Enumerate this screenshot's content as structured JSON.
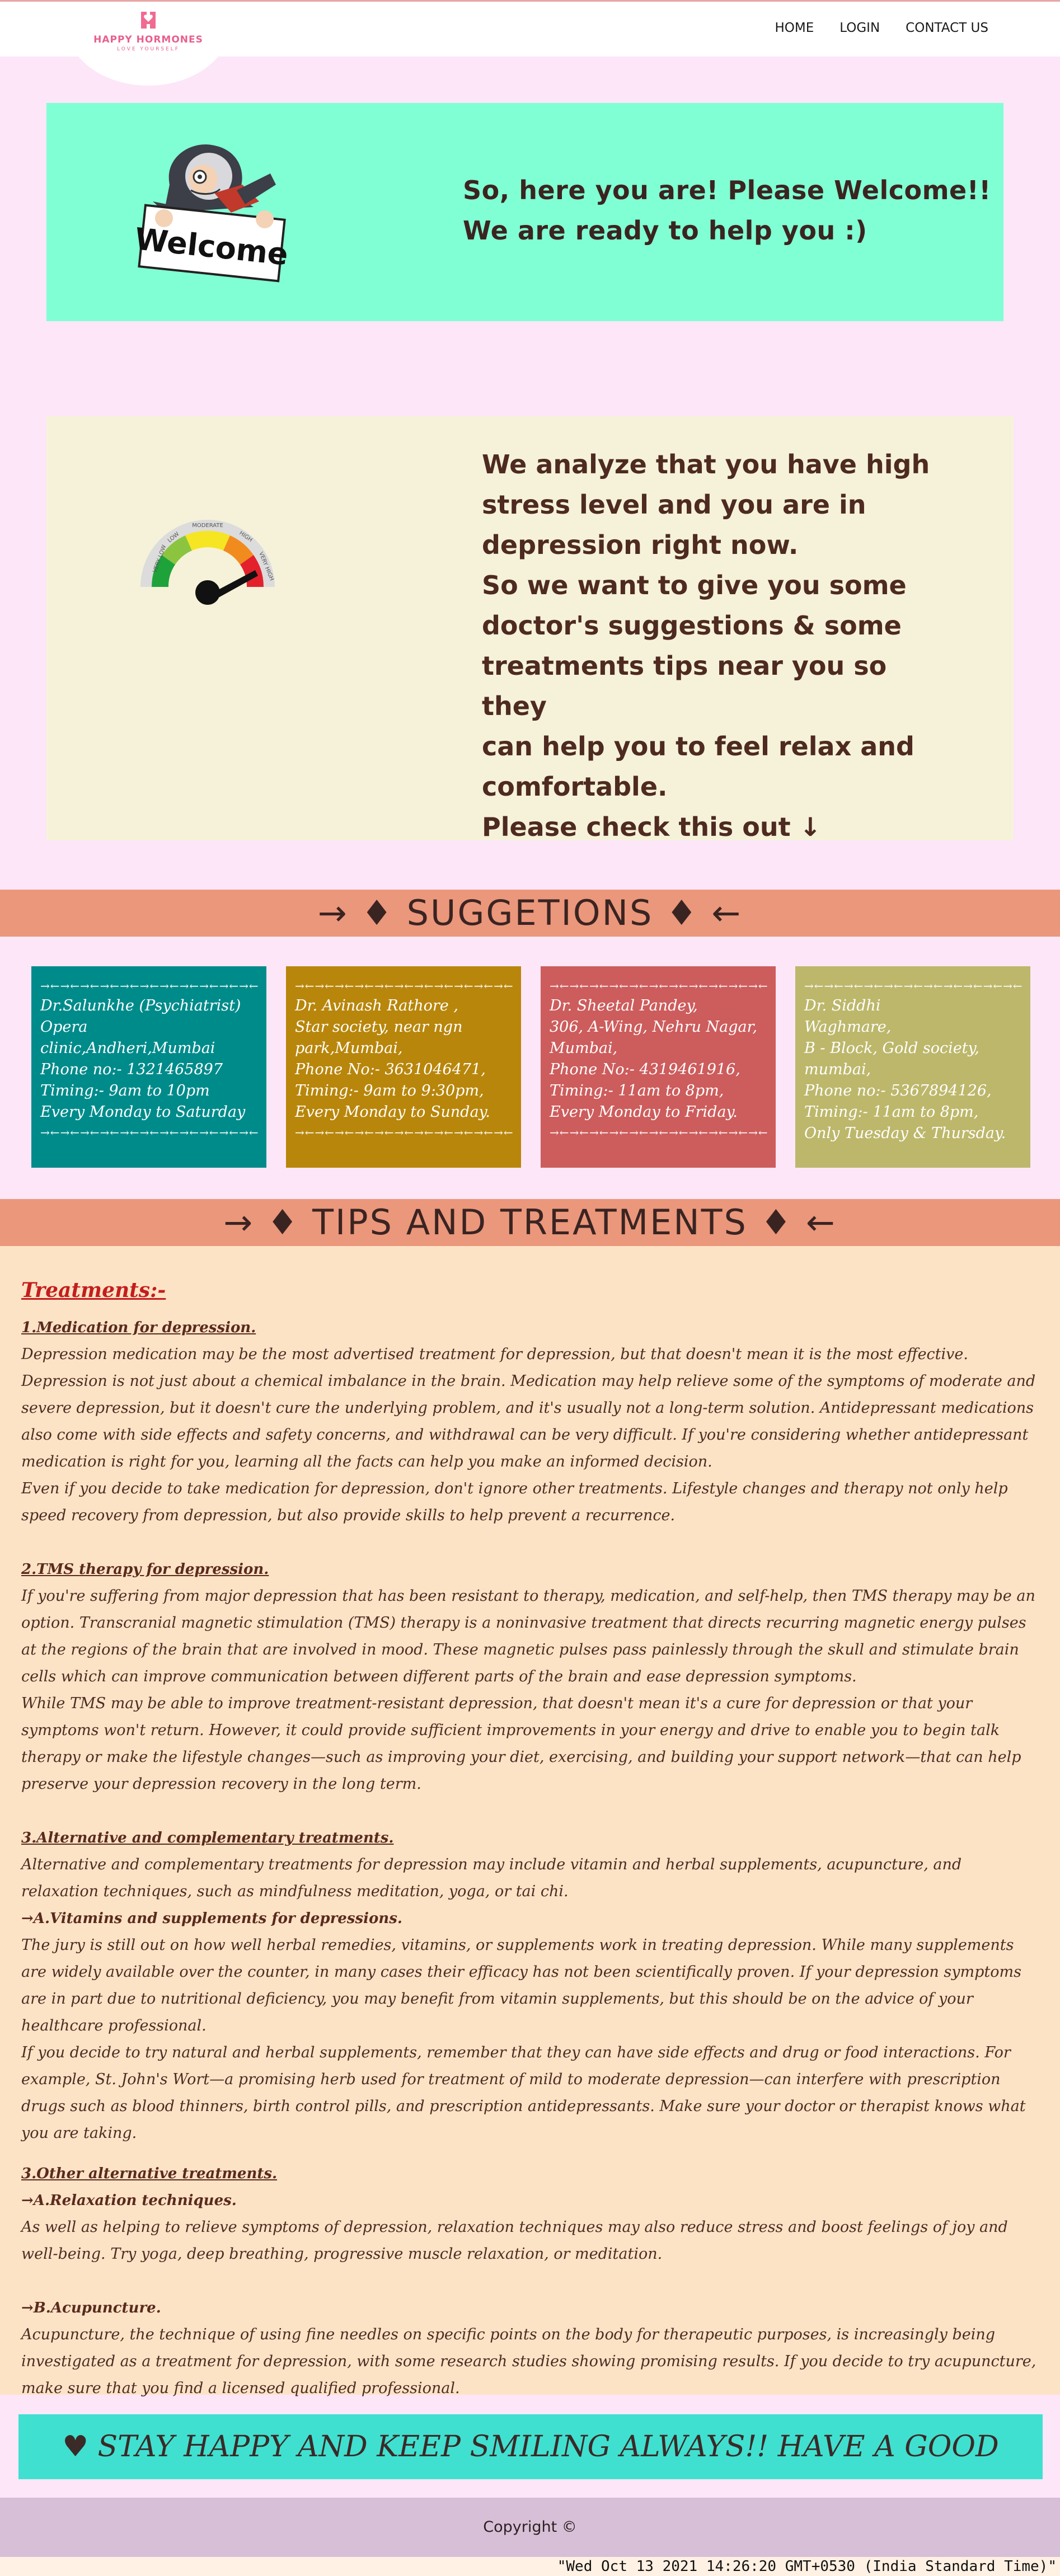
{
  "nav": {
    "logo_title": "HAPPY HORMONES",
    "logo_subtitle": "LOVE YOURSELF",
    "links": [
      "HOME",
      "LOGIN",
      "CONTACT US"
    ]
  },
  "welcome": {
    "sign_text": "Welcome",
    "line1": "So, here you are! Please Welcome!!",
    "line2": "We are ready to help you :)"
  },
  "stress": {
    "gauge_labels": [
      "VERY LOW",
      "LOW",
      "MODERATE",
      "HIGH",
      "VERY HIGH"
    ],
    "gauge_level": "high",
    "lines": [
      "We analyze that you have high",
      "stress level and you are in",
      "depression right now.",
      "So we want to give you some",
      "doctor's suggestions & some",
      "treatments tips near you so they",
      "can help you to feel relax and",
      "comfortable.",
      "Please check this out ↓"
    ]
  },
  "suggestions_banner": "→ ♦ SUGGETIONS ♦ ←",
  "doctors": [
    {
      "color": "#008b8b",
      "top_arrows": "→←→←→←→←→←→←→←→←→←→←→←",
      "lines": [
        "Dr.Salunkhe (Psychiatrist)",
        "Opera clinic,Andheri,Mumbai",
        "Phone no:- 1321465897",
        "Timing:- 9am to 10pm",
        "Every Monday to Saturday"
      ],
      "bottom_arrows": "→←→←→←→←→←→←→←→←→←→←→←"
    },
    {
      "color": "#b8860b",
      "top_arrows": "→←→←→←→←→←→←→←→←→←→←→←",
      "lines": [
        "Dr. Avinash Rathore ,",
        "Star society, near ngn",
        "park,Mumbai,",
        "Phone No:- 3631046471,",
        "Timing:- 9am to 9:30pm,",
        "Every Monday to Sunday."
      ],
      "bottom_arrows": "→←→←→←→←→←→←→←→←→←→←→←"
    },
    {
      "color": "#cd5c5c",
      "top_arrows": "→←→←→←→←→←→←→←→←→←→←→←",
      "lines": [
        "Dr. Sheetal Pandey,",
        "306, A-Wing, Nehru Nagar,",
        "Mumbai,",
        "Phone No:- 4319461916,",
        "Timing:- 11am to 8pm,",
        "Every Monday to Friday."
      ],
      "bottom_arrows": "→←→←→←→←→←→←→←→←→←→←→←"
    },
    {
      "color": "#bdb76b",
      "top_arrows": "→←→←→←→←→←→←→←→←→←→←→←",
      "lines": [
        "Dr. Siddhi",
        "Waghmare,",
        "B - Block, Gold society,",
        "mumbai,",
        "Phone no:- 5367894126,",
        "Timing:- 11am to 8pm,",
        "Only Tuesday & Thursday."
      ],
      "bottom_arrows": "→←→←→←→←→←→←→←→←→←→←→←"
    }
  ],
  "tips_banner": "→ ♦ TIPS AND TREATMENTS ♦ ←",
  "tips": {
    "heading": "Treatments:-",
    "s1_title": "1.Medication for depression.",
    "s1_p1": "Depression medication may be the most advertised treatment for depression, but that doesn't mean it is the most effective. Depression is not just about a chemical imbalance in the brain. Medication may help relieve some of the symptoms of moderate and severe depression, but it doesn't cure the underlying problem, and it's usually not a long-term solution. Antidepressant medications also come with side effects and safety concerns, and withdrawal can be very difficult. If you're considering whether antidepressant medication is right for you, learning all the facts can help you make an informed decision.",
    "s1_p2": "Even if you decide to take medication for depression, don't ignore other treatments. Lifestyle changes and therapy not only help speed recovery from depression, but also provide skills to help prevent a recurrence.",
    "s2_title": "2.TMS therapy for depression.",
    "s2_p1": "If you're suffering from major depression that has been resistant to therapy, medication, and self-help, then TMS therapy may be an option. Transcranial magnetic stimulation (TMS) therapy is a noninvasive treatment that directs recurring magnetic energy pulses at the regions of the brain that are involved in mood. These magnetic pulses pass painlessly through the skull and stimulate brain cells which can improve communication between different parts of the brain and ease depression symptoms.",
    "s2_p2": "While TMS may be able to improve treatment-resistant depression, that doesn't mean it's a cure for depression or that your symptoms won't return. However, it could provide sufficient improvements in your energy and drive to enable you to begin talk therapy or make the lifestyle changes—such as improving your diet, exercising, and building your support network—that can help preserve your depression recovery in the long term.",
    "s3_title": "3.Alternative and complementary treatments.",
    "s3_p1": "Alternative and complementary treatments for depression may include vitamin and herbal supplements, acupuncture, and relaxation techniques, such as mindfulness meditation, yoga, or tai chi.",
    "s3_sub": "→A.Vitamins and supplements for depressions.",
    "s3_p2": "The jury is still out on how well herbal remedies, vitamins, or supplements work in treating depression. While many supplements are widely available over the counter, in many cases their efficacy has not been scientifically proven. If your depression symptoms are in part due to nutritional deficiency, you may benefit from vitamin supplements, but this should be on the advice of your healthcare professional.",
    "s3_p3": "If you decide to try natural and herbal supplements, remember that they can have side effects and drug or food interactions. For example, St. John's Wort—a promising herb used for treatment of mild to moderate depression—can interfere with prescription drugs such as blood thinners, birth control pills, and prescription antidepressants. Make sure your doctor or therapist knows what you are taking.",
    "s4_title": "3.Other alternative treatments.",
    "s4_sub_a": "→A.Relaxation techniques.",
    "s4_p1": "As well as helping to relieve symptoms of depression, relaxation techniques may also reduce stress and boost feelings of joy and well-being. Try yoga, deep breathing, progressive muscle relaxation, or meditation.",
    "s4_sub_b": "→B.Acupuncture.",
    "s4_p2": "Acupuncture, the technique of using fine needles on specific points on the body for therapeutic purposes, is increasingly being investigated as a treatment for depression, with some research studies showing promising results. If you decide to try acupuncture, make sure that you find a licensed qualified professional."
  },
  "motto": "♥ STAY HAPPY AND KEEP SMILING ALWAYS!! HAVE A GOOD DAY!! ♥",
  "footer": {
    "copyright": "Copyright ©",
    "datetime": "\"Wed Oct 13 2021 14:26:20 GMT+0530 (India Standard Time)\""
  }
}
